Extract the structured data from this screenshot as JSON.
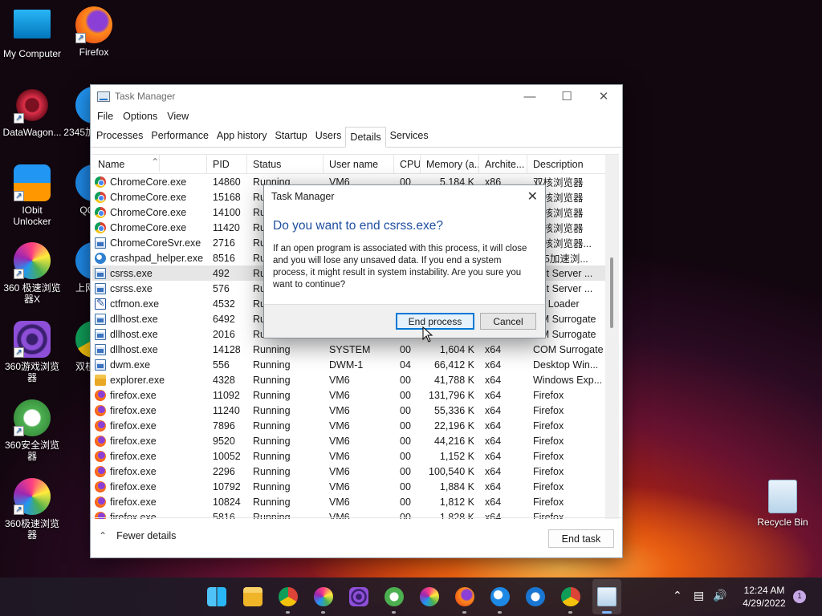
{
  "desktop": {
    "icons": [
      {
        "label": "My Computer"
      },
      {
        "label": "Firefox"
      },
      {
        "label": "DataWagon..."
      },
      {
        "label": "2345加"
      },
      {
        "label": "IObit\nUnlocker"
      },
      {
        "label": "QQ"
      },
      {
        "label": "360 极速浏览\n器X"
      },
      {
        "label": "上网"
      },
      {
        "label": "360游戏浏览\n器"
      },
      {
        "label": "双核"
      },
      {
        "label": "360安全浏览\n器"
      },
      {
        "label": "360极速浏览\n器"
      },
      {
        "label": "Recycle Bin"
      }
    ]
  },
  "window": {
    "title": "Task Manager",
    "menu": [
      "File",
      "Options",
      "View"
    ],
    "tabs": [
      "Processes",
      "Performance",
      "App history",
      "Startup",
      "Users",
      "Details",
      "Services"
    ],
    "active_tab": "Details",
    "columns": [
      "Name",
      "PID",
      "Status",
      "User name",
      "CPU",
      "Memory (a...",
      "Archite...",
      "Description"
    ],
    "rows": [
      {
        "name": "ChromeCore.exe",
        "icon": "chrome-icon",
        "pid": "14860",
        "status": "Running",
        "user": "VM6",
        "cpu": "00",
        "mem": "5,184 K",
        "arch": "x86",
        "desc": "双核浏览器"
      },
      {
        "name": "ChromeCore.exe",
        "icon": "chrome-icon",
        "pid": "15168",
        "status": "Ru",
        "user": "",
        "cpu": "",
        "mem": "",
        "arch": "",
        "desc": "双核浏览器"
      },
      {
        "name": "ChromeCore.exe",
        "icon": "chrome-icon",
        "pid": "14100",
        "status": "Ru",
        "user": "",
        "cpu": "",
        "mem": "",
        "arch": "",
        "desc": "双核浏览器"
      },
      {
        "name": "ChromeCore.exe",
        "icon": "chrome-icon",
        "pid": "11420",
        "status": "Ru",
        "user": "",
        "cpu": "",
        "mem": "",
        "arch": "",
        "desc": "双核浏览器"
      },
      {
        "name": "ChromeCoreSvr.exe",
        "icon": "window-icon",
        "pid": "2716",
        "status": "Ru",
        "user": "",
        "cpu": "",
        "mem": "",
        "arch": "",
        "desc": "双核浏览器..."
      },
      {
        "name": "crashpad_helper.exe",
        "icon": "edge-icon",
        "pid": "8516",
        "status": "Ru",
        "user": "",
        "cpu": "",
        "mem": "",
        "arch": "",
        "desc": "345加速浏..."
      },
      {
        "name": "csrss.exe",
        "icon": "window-icon",
        "pid": "492",
        "status": "Ru",
        "user": "",
        "cpu": "",
        "mem": "",
        "arch": "",
        "desc": "ient Server ...",
        "selected": true
      },
      {
        "name": "csrss.exe",
        "icon": "window-icon",
        "pid": "576",
        "status": "Ru",
        "user": "",
        "cpu": "",
        "mem": "",
        "arch": "",
        "desc": "ient Server ..."
      },
      {
        "name": "ctfmon.exe",
        "icon": "ctf-icon",
        "pid": "4532",
        "status": "Ru",
        "user": "",
        "cpu": "",
        "mem": "",
        "arch": "",
        "desc": "TF Loader"
      },
      {
        "name": "dllhost.exe",
        "icon": "window-icon",
        "pid": "6492",
        "status": "Ru",
        "user": "",
        "cpu": "",
        "mem": "",
        "arch": "",
        "desc": "OM Surrogate"
      },
      {
        "name": "dllhost.exe",
        "icon": "window-icon",
        "pid": "2016",
        "status": "Ru",
        "user": "",
        "cpu": "",
        "mem": "",
        "arch": "",
        "desc": "OM Surrogate"
      },
      {
        "name": "dllhost.exe",
        "icon": "window-icon",
        "pid": "14128",
        "status": "Running",
        "user": "SYSTEM",
        "cpu": "00",
        "mem": "1,604 K",
        "arch": "x64",
        "desc": "COM Surrogate"
      },
      {
        "name": "dwm.exe",
        "icon": "window-icon",
        "pid": "556",
        "status": "Running",
        "user": "DWM-1",
        "cpu": "04",
        "mem": "66,412 K",
        "arch": "x64",
        "desc": "Desktop Win..."
      },
      {
        "name": "explorer.exe",
        "icon": "folder-icon",
        "pid": "4328",
        "status": "Running",
        "user": "VM6",
        "cpu": "00",
        "mem": "41,788 K",
        "arch": "x64",
        "desc": "Windows Exp..."
      },
      {
        "name": "firefox.exe",
        "icon": "firefox-icon",
        "pid": "11092",
        "status": "Running",
        "user": "VM6",
        "cpu": "00",
        "mem": "131,796 K",
        "arch": "x64",
        "desc": "Firefox"
      },
      {
        "name": "firefox.exe",
        "icon": "firefox-icon",
        "pid": "11240",
        "status": "Running",
        "user": "VM6",
        "cpu": "00",
        "mem": "55,336 K",
        "arch": "x64",
        "desc": "Firefox"
      },
      {
        "name": "firefox.exe",
        "icon": "firefox-icon",
        "pid": "7896",
        "status": "Running",
        "user": "VM6",
        "cpu": "00",
        "mem": "22,196 K",
        "arch": "x64",
        "desc": "Firefox"
      },
      {
        "name": "firefox.exe",
        "icon": "firefox-icon",
        "pid": "9520",
        "status": "Running",
        "user": "VM6",
        "cpu": "00",
        "mem": "44,216 K",
        "arch": "x64",
        "desc": "Firefox"
      },
      {
        "name": "firefox.exe",
        "icon": "firefox-icon",
        "pid": "10052",
        "status": "Running",
        "user": "VM6",
        "cpu": "00",
        "mem": "1,152 K",
        "arch": "x64",
        "desc": "Firefox"
      },
      {
        "name": "firefox.exe",
        "icon": "firefox-icon",
        "pid": "2296",
        "status": "Running",
        "user": "VM6",
        "cpu": "00",
        "mem": "100,540 K",
        "arch": "x64",
        "desc": "Firefox"
      },
      {
        "name": "firefox.exe",
        "icon": "firefox-icon",
        "pid": "10792",
        "status": "Running",
        "user": "VM6",
        "cpu": "00",
        "mem": "1,884 K",
        "arch": "x64",
        "desc": "Firefox"
      },
      {
        "name": "firefox.exe",
        "icon": "firefox-icon",
        "pid": "10824",
        "status": "Running",
        "user": "VM6",
        "cpu": "00",
        "mem": "1,812 K",
        "arch": "x64",
        "desc": "Firefox"
      },
      {
        "name": "firefox.exe",
        "icon": "firefox-icon",
        "pid": "5816",
        "status": "Running",
        "user": "VM6",
        "cpu": "00",
        "mem": "1,828 K",
        "arch": "x64",
        "desc": "Firefox"
      }
    ],
    "footer": {
      "fewer_details": "Fewer details",
      "end_task": "End task"
    }
  },
  "dialog": {
    "title": "Task Manager",
    "question": "Do you want to end csrss.exe?",
    "body": "If an open program is associated with this process, it will close and you will lose any unsaved data. If you end a system process, it might result in system instability. Are you sure you want to continue?",
    "end_process": "End process",
    "cancel": "Cancel"
  },
  "taskbar": {
    "clock_time": "12:24 AM",
    "clock_date": "4/29/2022",
    "notification_count": "1"
  }
}
